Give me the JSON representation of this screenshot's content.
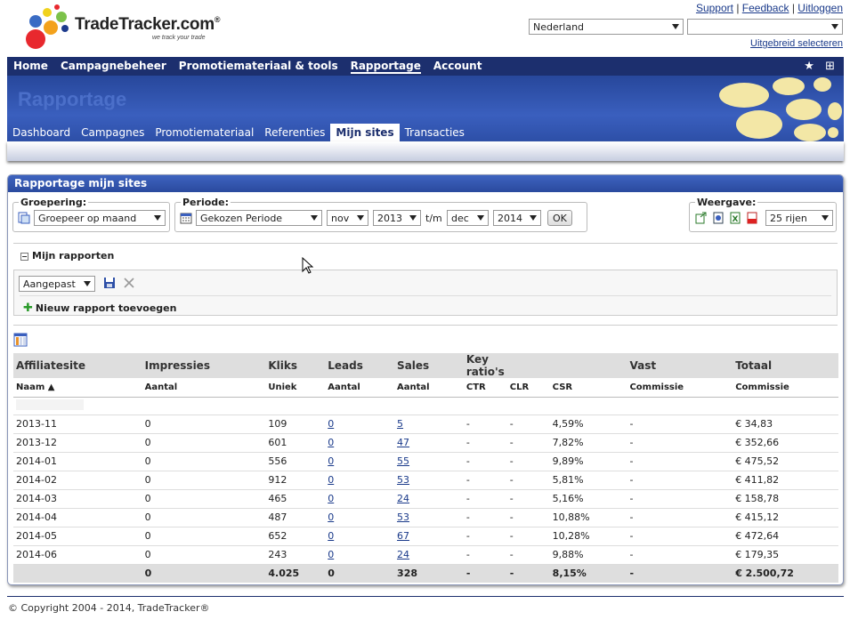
{
  "brand": {
    "name": "TradeTracker.com",
    "reg": "®",
    "tagline": "we track your trade"
  },
  "toplinks": {
    "support": "Support",
    "feedback": "Feedback",
    "logout": "Uitloggen",
    "sep": "|"
  },
  "country_select": {
    "value": "Nederland"
  },
  "advanced_select": "Uitgebreid selecteren",
  "mainnav": [
    "Home",
    "Campagnebeheer",
    "Promotiemateriaal & tools",
    "Rapportage",
    "Account"
  ],
  "mainnav_active": "Rapportage",
  "banner_title": "Rapportage",
  "subnav": [
    "Dashboard",
    "Campagnes",
    "Promotiemateriaal",
    "Referenties",
    "Mijn sites",
    "Transacties"
  ],
  "subnav_active": "Mijn sites",
  "panel": {
    "title": "Rapportage mijn sites",
    "grouping": {
      "label": "Groepering:",
      "value": "Groepeer op maand"
    },
    "period": {
      "label": "Periode:",
      "value": "Gekozen Periode",
      "from_month": "nov",
      "from_year": "2013",
      "to_label": "t/m",
      "to_month": "dec",
      "to_year": "2014",
      "ok": "OK"
    },
    "view": {
      "label": "Weergave:",
      "rows": "25 rijen"
    },
    "reports": {
      "title": "Mijn rapporten",
      "select": "Aangepast",
      "add": "Nieuw rapport toevoegen"
    }
  },
  "table": {
    "group_headers": [
      "Affiliatesite",
      "Impressies",
      "Kliks",
      "Leads",
      "Sales",
      "Key ratio's",
      "",
      "",
      "Vast",
      "Totaal"
    ],
    "sub_headers": [
      "Naam ▲",
      "Aantal",
      "Uniek",
      "Aantal",
      "Aantal",
      "CTR",
      "CLR",
      "CSR",
      "Commissie",
      "Commissie"
    ],
    "rows": [
      [
        "2013-11",
        "0",
        "109",
        "0",
        "5",
        "-",
        "-",
        "4,59%",
        "-",
        "€ 34,83"
      ],
      [
        "2013-12",
        "0",
        "601",
        "0",
        "47",
        "-",
        "-",
        "7,82%",
        "-",
        "€ 352,66"
      ],
      [
        "2014-01",
        "0",
        "556",
        "0",
        "55",
        "-",
        "-",
        "9,89%",
        "-",
        "€ 475,52"
      ],
      [
        "2014-02",
        "0",
        "912",
        "0",
        "53",
        "-",
        "-",
        "5,81%",
        "-",
        "€ 411,82"
      ],
      [
        "2014-03",
        "0",
        "465",
        "0",
        "24",
        "-",
        "-",
        "5,16%",
        "-",
        "€ 158,78"
      ],
      [
        "2014-04",
        "0",
        "487",
        "0",
        "53",
        "-",
        "-",
        "10,88%",
        "-",
        "€ 415,12"
      ],
      [
        "2014-05",
        "0",
        "652",
        "0",
        "67",
        "-",
        "-",
        "10,28%",
        "-",
        "€ 472,64"
      ],
      [
        "2014-06",
        "0",
        "243",
        "0",
        "24",
        "-",
        "-",
        "9,88%",
        "-",
        "€ 179,35"
      ]
    ],
    "total": [
      "",
      "0",
      "4.025",
      "0",
      "328",
      "-",
      "-",
      "8,15%",
      "-",
      "€ 2.500,72"
    ]
  },
  "footer": "© Copyright 2004 - 2014, TradeTracker®",
  "colors": {
    "nav": "#1c2f6e",
    "banner": "#3a5fbe",
    "link": "#1a3a8a"
  }
}
